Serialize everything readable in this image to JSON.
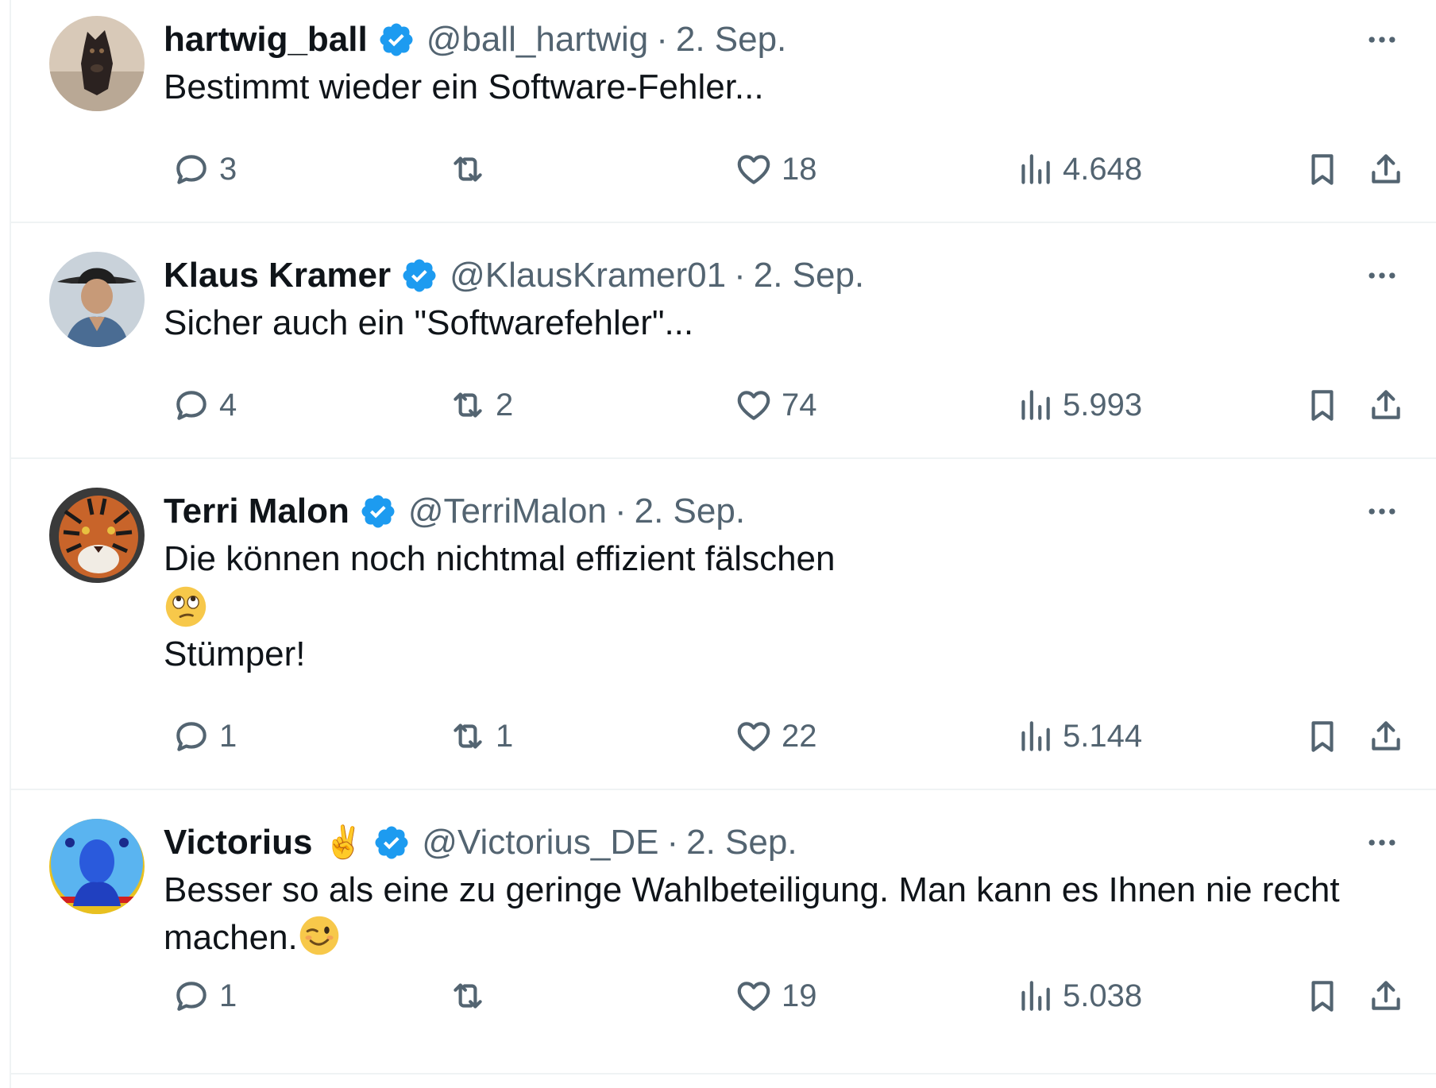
{
  "colors": {
    "text_primary": "#0f1419",
    "text_secondary": "#536471",
    "verified_badge": "#1d9bf0",
    "divider": "#eff3f4"
  },
  "icons": {
    "reply": "speech-bubble-icon",
    "retweet": "retweet-arrows-icon",
    "like": "heart-icon",
    "views": "bar-chart-icon",
    "bookmark": "bookmark-icon",
    "share": "upload-share-icon",
    "more": "three-dots-icon",
    "verified": "verified-checkmark-icon"
  },
  "tweets": [
    {
      "name": "hartwig_ball",
      "name_emoji": "",
      "handle": "@ball_hartwig",
      "separator": "·",
      "date": "2. Sep.",
      "text_lines": [
        "Bestimmt wieder ein Software-Fehler..."
      ],
      "emoji_line": "",
      "text_after": "",
      "replies": "3",
      "retweets": "",
      "likes": "18",
      "views": "4.648"
    },
    {
      "name": "Klaus Kramer",
      "name_emoji": "",
      "handle": "@KlausKramer01",
      "separator": "·",
      "date": "2. Sep.",
      "text_lines": [
        "Sicher auch ein \"Softwarefehler\"..."
      ],
      "emoji_line": "",
      "text_after": "",
      "replies": "4",
      "retweets": "2",
      "likes": "74",
      "views": "5.993"
    },
    {
      "name": "Terri Malon",
      "name_emoji": "",
      "handle": "@TerriMalon",
      "separator": "·",
      "date": "2. Sep.",
      "text_lines": [
        "Die können noch nichtmal effizient fälschen"
      ],
      "emoji_line": "rolling-eyes-emoji",
      "text_after": "Stümper!",
      "replies": "1",
      "retweets": "1",
      "likes": "22",
      "views": "5.144"
    },
    {
      "name": "Victorius",
      "name_emoji": "✌️",
      "handle": "@Victorius_DE",
      "separator": "·",
      "date": "2. Sep.",
      "text_lines": [
        "Besser so als eine zu geringe Wahlbeteiligung. Man kann es Ihnen nie recht",
        "machen."
      ],
      "emoji_line": "",
      "trailing_emoji": "winking-face-emoji",
      "text_after": "",
      "replies": "1",
      "retweets": "",
      "likes": "19",
      "views": "5.038"
    }
  ]
}
